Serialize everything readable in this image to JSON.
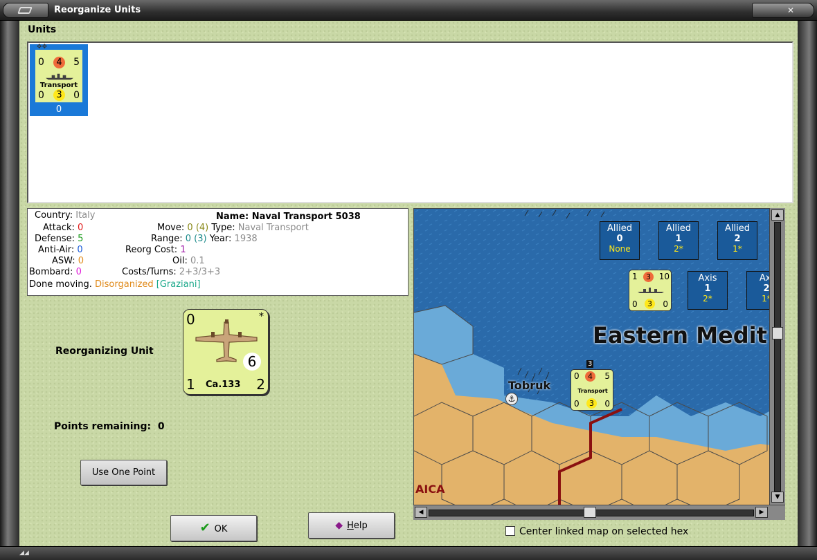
{
  "window": {
    "title": "Reorganize Units"
  },
  "units": {
    "label": "Units",
    "items": [
      {
        "tl": "0",
        "attack": "4",
        "tr": "5",
        "bl": "0",
        "defense": "3",
        "br": "0",
        "name": "Transport",
        "below": "0"
      }
    ]
  },
  "info": {
    "country_label": "Country:",
    "country": "Italy",
    "name_label": "Name:",
    "name": "Naval Transport 5038",
    "attack_label": "Attack:",
    "attack": "0",
    "move_label": "Move:",
    "move": "0",
    "move_extra": "(4)",
    "type_label": "Type:",
    "type": "Naval Transport",
    "defense_label": "Defense:",
    "defense": "5",
    "range_label": "Range:",
    "range": "0",
    "range_extra": "(3)",
    "year_label": "Year:",
    "year": "1938",
    "antiair_label": "Anti-Air:",
    "antiair": "0",
    "reorg_label": "Reorg Cost:",
    "reorg": "1",
    "asw_label": "ASW:",
    "asw": "0",
    "oil_label": "Oil:",
    "oil": "0.1",
    "bombard_label": "Bombard:",
    "bombard": "0",
    "costs_label": "Costs/Turns:",
    "costs": "2+3/3+3",
    "status_prefix": "Done moving.",
    "status": "Disorganized",
    "leader": "[Graziani]"
  },
  "reorg": {
    "label": "Reorganizing Unit",
    "counter": {
      "tl": "0",
      "star": "*",
      "bl": "1",
      "br": "2",
      "value": "6",
      "name": "Ca.133"
    },
    "points_label": "Points remaining:",
    "points": "0",
    "use_button": "Use One Point"
  },
  "buttons": {
    "ok": "OK",
    "help_pre": "",
    "help_ul": "H",
    "help_post": "elp"
  },
  "map": {
    "region_label": "Eastern Medit",
    "city": "Tobruk",
    "area_label": "AICA",
    "boxes": [
      {
        "title": "Allied",
        "num": "0",
        "sub": "None"
      },
      {
        "title": "Allied",
        "num": "1",
        "sub": "2*"
      },
      {
        "title": "Allied",
        "num": "2",
        "sub": "1*"
      },
      {
        "title": "Axis",
        "num": "1",
        "sub": "2*"
      },
      {
        "title": "Axi",
        "num": "2",
        "sub": "1*"
      }
    ],
    "counter_a": {
      "tl": "1",
      "attack": "3",
      "tr": "10",
      "bl": "0",
      "defense": "3",
      "br": "0"
    },
    "counter_b": {
      "tl": "0",
      "attack": "4",
      "tr": "5",
      "bl": "0",
      "defense": "3",
      "br": "0",
      "name": "Transport",
      "stack": "3"
    }
  },
  "center_checkbox": {
    "label": "Center linked map on selected hex",
    "checked": false
  }
}
